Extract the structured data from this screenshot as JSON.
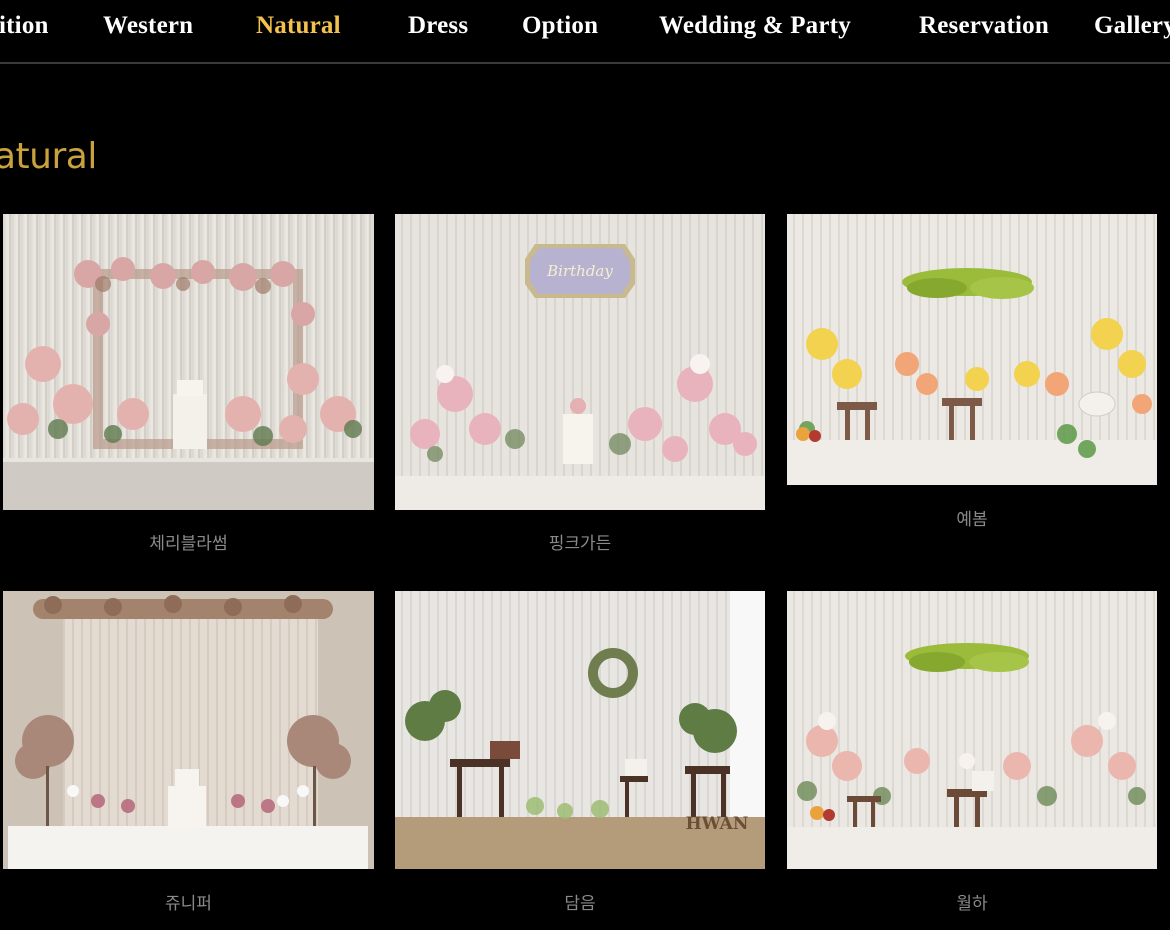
{
  "nav": {
    "items": [
      {
        "label": "ition",
        "active": false
      },
      {
        "label": "Western",
        "active": false
      },
      {
        "label": "Natural",
        "active": true
      },
      {
        "label": "Dress",
        "active": false
      },
      {
        "label": "Option",
        "active": false
      },
      {
        "label": "Wedding & Party",
        "active": false
      },
      {
        "label": "Reservation",
        "active": false
      },
      {
        "label": "Gallery",
        "active": false
      }
    ],
    "active_color": "#f2c14e"
  },
  "page": {
    "title": "atural"
  },
  "gallery": {
    "items": [
      {
        "name": "체리블라썸",
        "photo": "cherry-blossom-flower-arch-table"
      },
      {
        "name": "핑크가든",
        "photo": "pink-garden-birthday-table",
        "sign_text": "Birthday"
      },
      {
        "name": "예봄",
        "photo": "yellow-tulip-table-hanging-greenery"
      },
      {
        "name": "쥬니퍼",
        "photo": "juniper-dried-flower-table"
      },
      {
        "name": "담음",
        "photo": "wreath-wooden-stand-table",
        "watermark": "HWAN"
      },
      {
        "name": "월하",
        "photo": "pastel-flowers-hanging-greenery-table"
      }
    ]
  }
}
